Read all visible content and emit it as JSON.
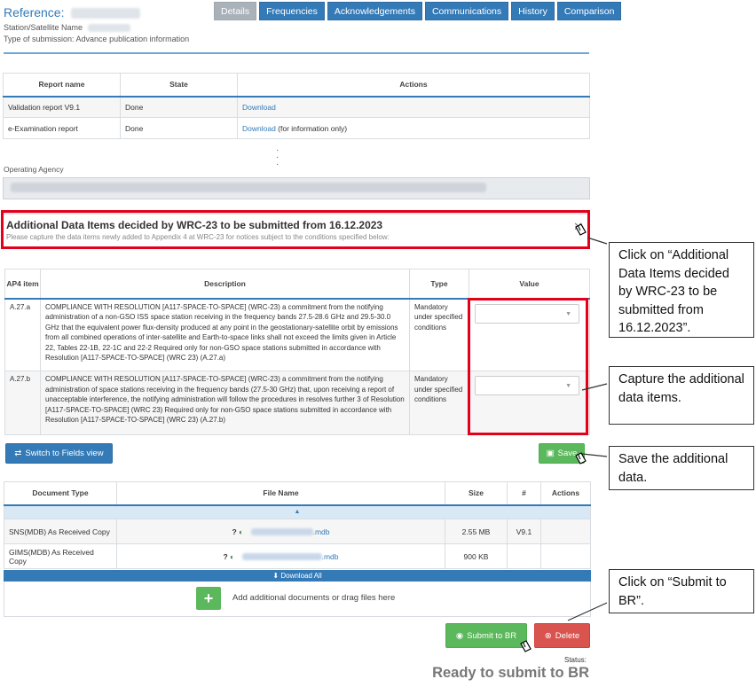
{
  "header": {
    "reference_label": "Reference:",
    "station_label": "Station/Satellite Name",
    "submission_type": "Type of submission: Advance publication information"
  },
  "tabs": [
    "Details",
    "Frequencies",
    "Acknowledgements",
    "Communications",
    "History",
    "Comparison"
  ],
  "reports": {
    "columns": [
      "Report name",
      "State",
      "Actions"
    ],
    "rows": [
      {
        "name": "Validation report V9.1",
        "state": "Done",
        "action": "Download",
        "note": ""
      },
      {
        "name": "e-Examination report",
        "state": "Done",
        "action": "Download",
        "note": " (for information only)"
      }
    ]
  },
  "operating_agency": {
    "label": "Operating Agency"
  },
  "wrc": {
    "title": "Additional Data Items decided by WRC-23 to be submitted from 16.12.2023",
    "subtitle": "Please capture the data items newly added to Appendix 4 at WRC-23 for notices subject to the conditions specified below:",
    "close": "✕"
  },
  "items": {
    "columns": {
      "ap4": "AP4 item",
      "description": "Description",
      "type": "Type",
      "value": "Value"
    },
    "rows": [
      {
        "ap4": "A.27.a",
        "description": "COMPLIANCE WITH RESOLUTION [A117-SPACE-TO-SPACE] (WRC-23) a commitment from the notifying administration of a non-GSO ISS space station receiving in the frequency bands 27.5-28.6 GHz and 29.5-30.0 GHz that the equivalent power flux-density produced at any point in the geostationary-satellite orbit by emissions from all combined operations of inter-satellite and Earth-to-space links shall not exceed the limits given in Article 22, Tables 22-1B, 22-1C and 22-2 Required only for non-GSO space stations submitted in accordance with Resolution [A117-SPACE-TO-SPACE] (WRC 23) (A.27.a)",
        "type": "Mandatory under specified conditions",
        "value": ""
      },
      {
        "ap4": "A.27.b",
        "description": "COMPLIANCE WITH RESOLUTION [A117-SPACE-TO-SPACE] (WRC-23) a commitment from the notifying administration of space stations receiving in the frequency bands (27.5-30 GHz) that, upon receiving a report of unacceptable interference, the notifying administration will follow the procedures in resolves further 3 of Resolution [A117-SPACE-TO-SPACE] (WRC 23) Required only for non-GSO space stations submitted in accordance with Resolution [A117-SPACE-TO-SPACE] (WRC 23) (A.27.b)",
        "type": "Mandatory under specified conditions",
        "value": ""
      }
    ]
  },
  "buttons": {
    "switch_view": "Switch to Fields view",
    "save": "Save",
    "download_all": "Download All",
    "submit": "Submit to BR",
    "delete": "Delete"
  },
  "documents": {
    "columns": [
      "Document Type",
      "File Name",
      "Size",
      "#",
      "Actions"
    ],
    "rows": [
      {
        "type": "SNS(MDB) As Received Copy",
        "file_ext": ".mdb",
        "size": "2.55 MB",
        "version": "V9.1"
      },
      {
        "type": "GIMS(MDB) As Received Copy",
        "file_ext": ".mdb",
        "size": "900 KB",
        "version": ""
      }
    ],
    "dropzone_text": "Add additional documents or drag files here"
  },
  "status": {
    "label": "Status:",
    "value": "Ready to submit to BR"
  },
  "callouts": {
    "wrc": "Click on “Additional Data Items decided by WRC-23 to be submitted from 16.12.2023”.",
    "capture": "Capture the additional data items.",
    "save": "Save the additional data.",
    "submit": "Click on “Submit to BR”."
  },
  "colors": {
    "primary": "#337ab7",
    "success": "#5cb85c",
    "danger": "#d9534f",
    "highlight": "#e2001a"
  }
}
